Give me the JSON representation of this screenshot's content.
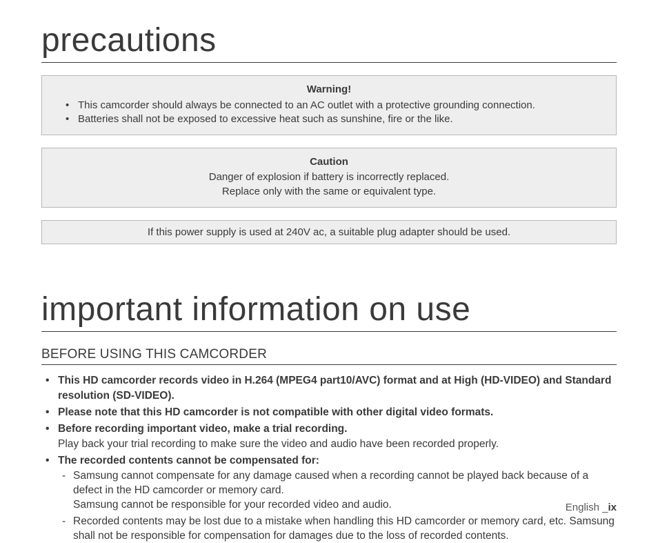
{
  "precautions": {
    "heading": "precautions",
    "warning": {
      "title": "Warning!",
      "items": [
        "This camcorder should always be connected to an AC outlet with a protective grounding connection.",
        "Batteries shall not be exposed to excessive heat such as sunshine, fire or the like."
      ]
    },
    "caution": {
      "title": "Caution",
      "line1": "Danger of explosion if battery is incorrectly replaced.",
      "line2": "Replace only with the same or equivalent type."
    },
    "note": "If this power supply is used at 240V ac, a suitable plug adapter should be used."
  },
  "important": {
    "heading": "important information on use",
    "subheading": "BEFORE USING THIS CAMCORDER",
    "items": [
      {
        "bold": "This HD camcorder records video in H.264 (MPEG4 part10/AVC) format and at High (HD-VIDEO) and Standard resolution (SD-VIDEO)."
      },
      {
        "bold": "Please note that this HD camcorder is not compatible with other digital video formats."
      },
      {
        "bold": "Before recording important video, make a trial recording.",
        "normal": "Play back your trial recording to make sure the video and audio have been recorded properly."
      },
      {
        "bold": "The recorded contents cannot be compensated for:",
        "sub": [
          "Samsung cannot compensate for any damage caused when a recording cannot be played back because of a defect in the HD camcorder or memory card.\nSamsung cannot be responsible for your recorded video and audio.",
          "Recorded contents may be lost due to a mistake when handling this HD camcorder or memory card, etc. Samsung shall not be responsible for compensation for damages due to the loss of recorded contents."
        ]
      }
    ]
  },
  "footer": {
    "lang": "English _",
    "page": "ix"
  }
}
